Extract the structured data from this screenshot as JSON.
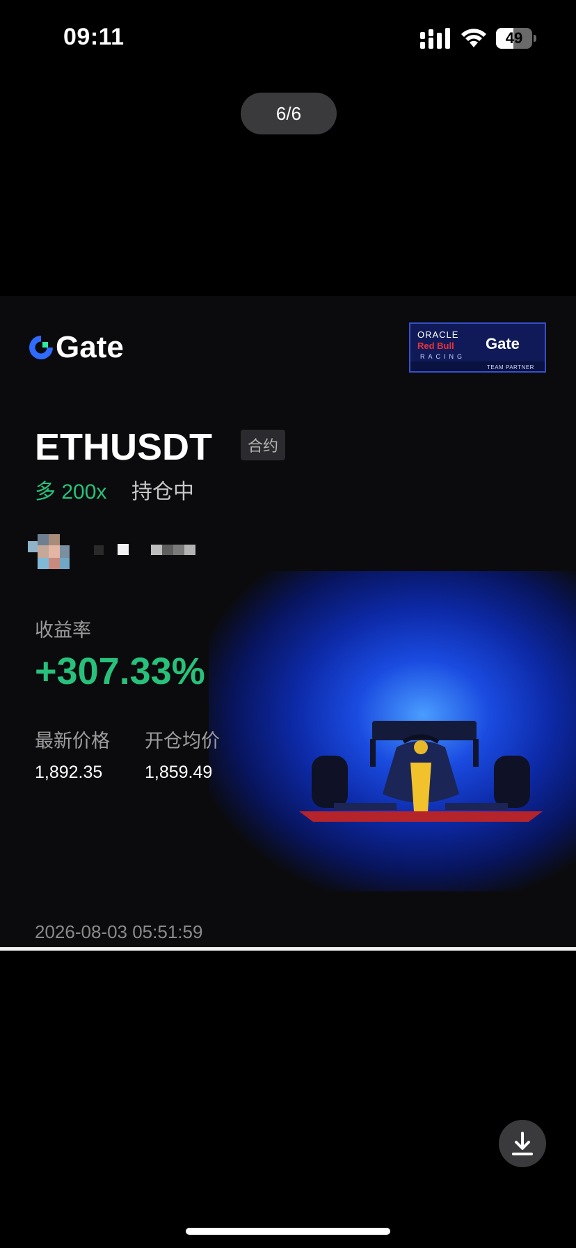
{
  "status_bar": {
    "time": "09:11",
    "battery_level": "49",
    "icons": [
      "signal-icon",
      "wifi-icon",
      "battery-icon"
    ]
  },
  "viewer": {
    "page_indicator": "6/6",
    "download_icon": "download-icon"
  },
  "card": {
    "brand": "Gate",
    "partner_badge": {
      "line1": "ORACLE",
      "line2": "Red Bull",
      "line3": "RACING",
      "brand": "Gate",
      "caption": "TEAM PARTNER"
    },
    "symbol": "ETHUSDT",
    "contract_tag": "合约",
    "direction": "多 200x",
    "position_status": "持仓中",
    "roi_label": "收益率",
    "roi_value": "+307.33%",
    "latest_price_label": "最新价格",
    "latest_price": "1,892.35",
    "avg_open_label": "开仓均价",
    "avg_open_price": "1,859.49",
    "timestamp": "2026-08-03 05:51:59",
    "colors": {
      "positive": "#27c17b",
      "brand_blue": "#2f6bff",
      "background": "#0b0b0d"
    }
  }
}
